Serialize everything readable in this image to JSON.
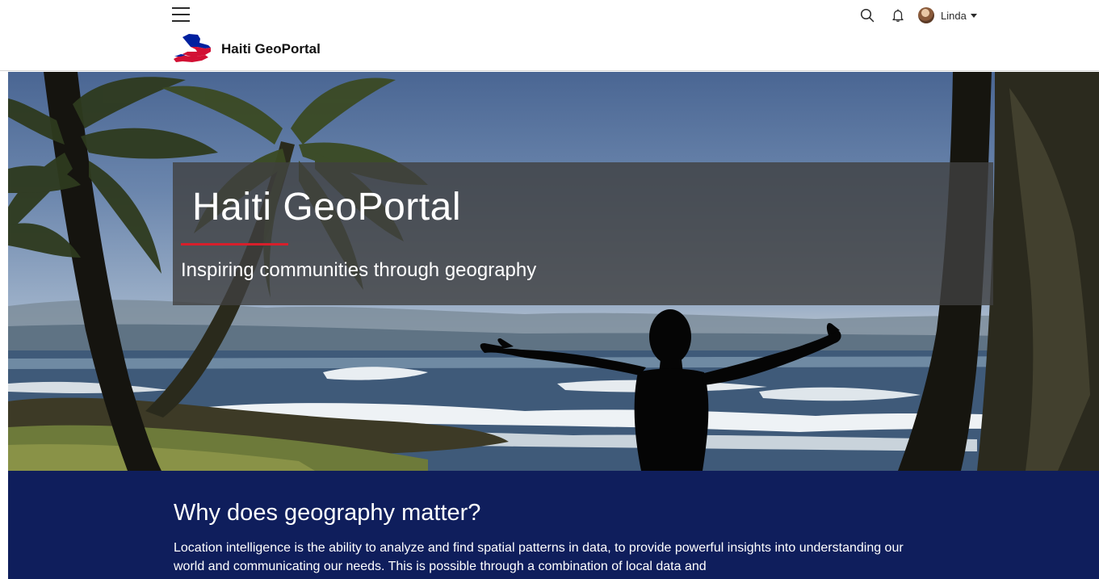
{
  "header": {
    "site_name": "Haiti GeoPortal",
    "user": {
      "name": "Linda"
    },
    "icons": {
      "menu": "hamburger-menu-icon",
      "search": "search-icon",
      "notifications": "bell-icon",
      "dropdown": "caret-down-icon"
    }
  },
  "hero": {
    "title": "Haiti GeoPortal",
    "subtitle": "Inspiring communities through geography"
  },
  "section": {
    "heading": "Why does geography matter?",
    "body": "Location intelligence is the ability to analyze and find spatial patterns in data, to provide powerful insights into understanding our world and communicating our needs. This is possible through a combination of local data and"
  },
  "colors": {
    "accent_red": "#d71f2b",
    "navy": "#0f1e5c",
    "panel_overlay": "#404040",
    "flag_blue": "#00209f",
    "flag_red": "#d21034"
  }
}
